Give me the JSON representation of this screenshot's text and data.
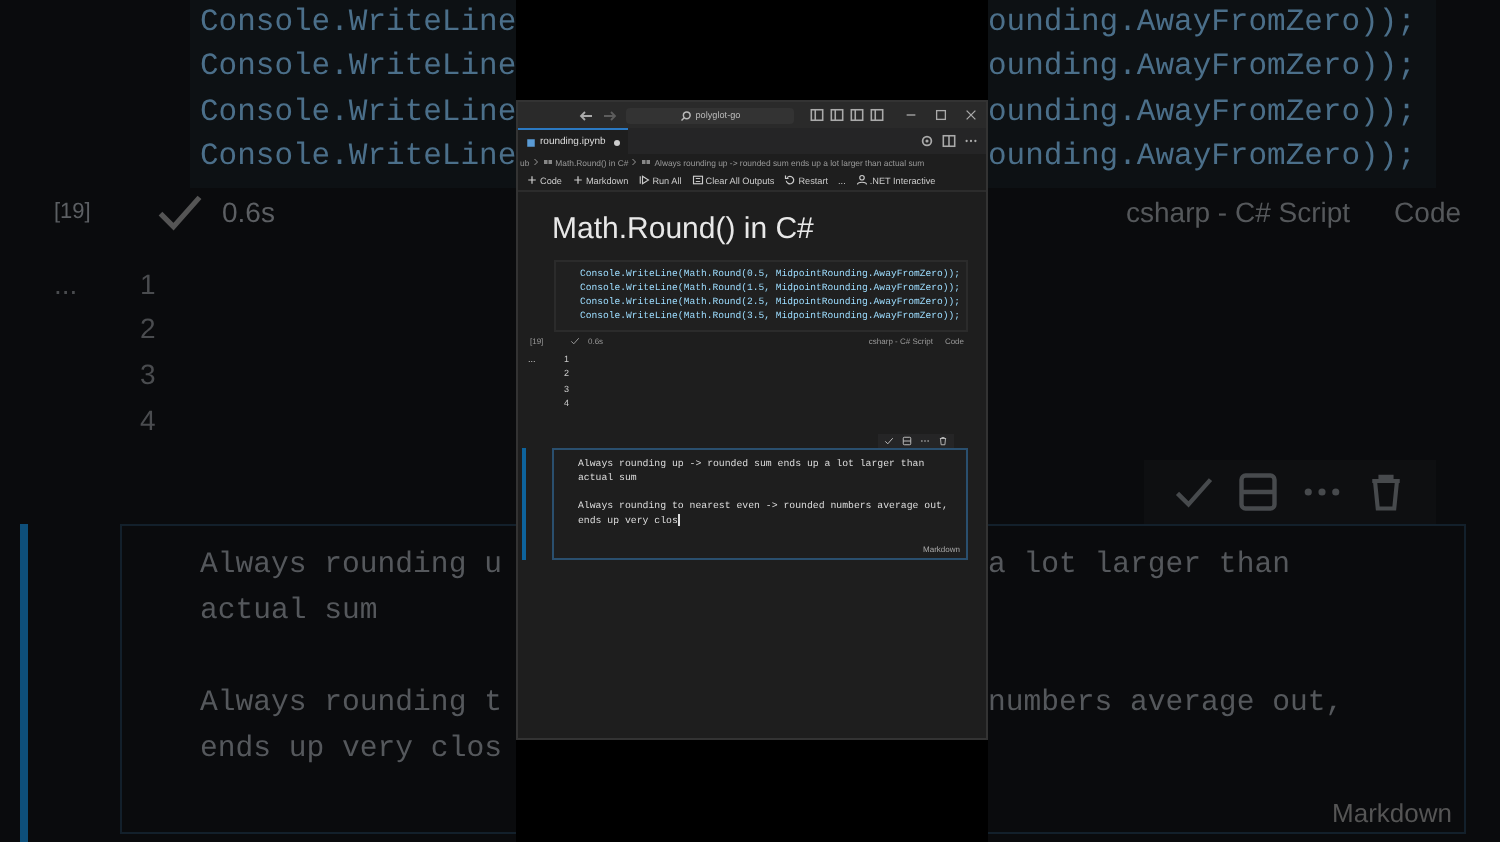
{
  "background": {
    "code_lines": [
      {
        "left": "Console.WriteLine",
        "right": "ounding.AwayFromZero));"
      },
      {
        "left": "Console.WriteLine",
        "right": "ounding.AwayFromZero));"
      },
      {
        "left": "Console.WriteLine",
        "right": "ounding.AwayFromZero));"
      },
      {
        "left": "Console.WriteLine",
        "right": "ounding.AwayFromZero));"
      }
    ],
    "cell_number": "[19]",
    "duration": "0.6s",
    "language": "csharp - C# Script",
    "cell_kind": "Code",
    "output_marker": "...",
    "output_lines": [
      "1",
      "2",
      "3",
      "4"
    ],
    "markdown_paragraphs": [
      {
        "lines": [
          {
            "left": "Always rounding u",
            "right": "a lot larger than"
          },
          {
            "left": "actual sum"
          }
        ]
      },
      {
        "lines": [
          {
            "left": "Always rounding t",
            "right": "numbers average out,"
          },
          {
            "left": "ends up very clos"
          }
        ]
      }
    ],
    "markdown_label": "Markdown",
    "markdown_focused": true
  },
  "window": {
    "search": "polyglot-go",
    "tab": {
      "label": "rounding.ipynb",
      "modified": true
    },
    "breadcrumb": [
      "ub",
      "Math.Round() in C#",
      "Always rounding up -> rounded sum ends up a lot larger than actual sum"
    ],
    "toolbar": [
      {
        "kind": "plus",
        "label": "Code"
      },
      {
        "kind": "plus",
        "label": "Markdown"
      },
      {
        "kind": "run",
        "label": "Run All"
      },
      {
        "kind": "clear",
        "label": "Clear All Outputs"
      },
      {
        "kind": "restart",
        "label": "Restart"
      },
      {
        "kind": "more",
        "label": "..."
      },
      {
        "kind": "kernel",
        "label": ".NET Interactive"
      }
    ],
    "heading": "Math.Round() in C#",
    "code_cell": {
      "lines": [
        "Console.WriteLine(Math.Round(0.5, MidpointRounding.AwayFromZero));",
        "Console.WriteLine(Math.Round(1.5, MidpointRounding.AwayFromZero));",
        "Console.WriteLine(Math.Round(2.5, MidpointRounding.AwayFromZero));",
        "Console.WriteLine(Math.Round(3.5, MidpointRounding.AwayFromZero));"
      ],
      "cell_number": "[19]",
      "duration": "0.6s",
      "language": "csharp - C# Script",
      "cell_kind": "Code"
    },
    "output_marker": "...",
    "output_lines": [
      "1",
      "2",
      "3",
      "4"
    ],
    "markdown_cell": {
      "focused": true,
      "paragraphs": [
        [
          "Always rounding up -> rounded sum ends up a lot larger than",
          "actual sum"
        ],
        [
          "Always rounding to nearest even -> rounded numbers average out,",
          "ends up very clos"
        ]
      ],
      "label": "Markdown"
    }
  }
}
